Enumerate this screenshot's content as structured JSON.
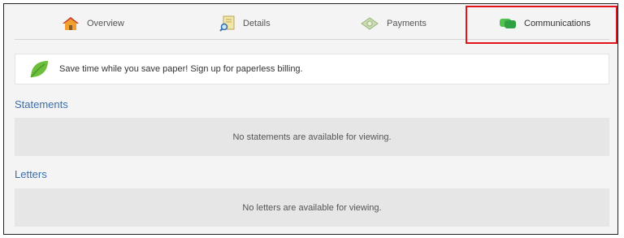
{
  "tabs": [
    {
      "label": "Overview",
      "icon": "house-icon"
    },
    {
      "label": "Details",
      "icon": "document-search-icon"
    },
    {
      "label": "Payments",
      "icon": "money-icon"
    },
    {
      "label": "Communications",
      "icon": "chat-bubbles-icon",
      "active": true
    }
  ],
  "banner": {
    "text": "Save time while you save paper! Sign up for paperless billing.",
    "icon": "leaf-icon"
  },
  "statements": {
    "title": "Statements",
    "empty_text": "No statements are available for viewing."
  },
  "letters": {
    "title": "Letters",
    "empty_text": "No letters are available for viewing."
  },
  "colors": {
    "accent": "#3b6ea8",
    "highlight": "#e1141c",
    "leaf": "#6cbf3a"
  }
}
